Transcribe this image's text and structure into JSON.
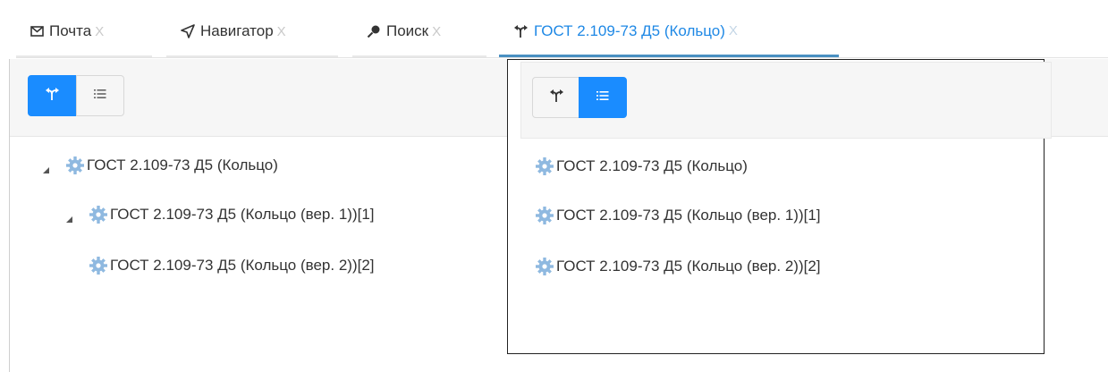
{
  "tabs": [
    {
      "label": "Почта",
      "icon": "mail-icon",
      "close": "X"
    },
    {
      "label": "Навигатор",
      "icon": "navigation-icon",
      "close": "X"
    },
    {
      "label": "Поиск",
      "icon": "search-icon",
      "close": "X"
    },
    {
      "label": "ГОСТ 2.109-73 Д5 (Кольцо)",
      "icon": "route-icon",
      "close": "X",
      "active": true
    }
  ],
  "left_panel": {
    "toolbar": {
      "tree_view_button": {
        "icon": "route-icon",
        "active": true
      },
      "list_view_button": {
        "icon": "list-icon",
        "active": false
      }
    },
    "tree": [
      {
        "label": "ГОСТ 2.109-73 Д5 (Кольцо)",
        "expanded": true,
        "icon": "gear-icon"
      },
      {
        "label": "ГОСТ 2.109-73 Д5 (Кольцо (вер. 1))[1]",
        "expanded": true,
        "icon": "gear-icon"
      },
      {
        "label": "ГОСТ 2.109-73 Д5 (Кольцо (вер. 2))[2]",
        "icon": "gear-icon"
      }
    ]
  },
  "popup": {
    "toolbar": {
      "tree_view_button": {
        "icon": "route-icon",
        "active": false
      },
      "list_view_button": {
        "icon": "list-icon",
        "active": true
      }
    },
    "list": [
      {
        "label": "ГОСТ 2.109-73 Д5 (Кольцо)",
        "icon": "gear-icon"
      },
      {
        "label": "ГОСТ 2.109-73 Д5 (Кольцо (вер. 1))[1]",
        "icon": "gear-icon"
      },
      {
        "label": "ГОСТ 2.109-73 Д5 (Кольцо (вер. 2))[2]",
        "icon": "gear-icon"
      }
    ]
  },
  "colors": {
    "accent": "#1a8cff",
    "active_tab_text": "#1e88e5",
    "gear": "#8fb9e0"
  }
}
